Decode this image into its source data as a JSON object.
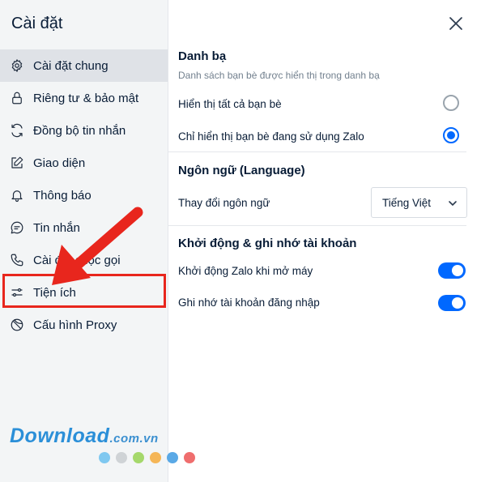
{
  "sidebar": {
    "title": "Cài đặt",
    "items": [
      {
        "label": "Cài đặt chung",
        "icon": "gear-icon"
      },
      {
        "label": "Riêng tư & bảo mật",
        "icon": "lock-icon"
      },
      {
        "label": "Đồng bộ tin nhắn",
        "icon": "sync-icon"
      },
      {
        "label": "Giao diện",
        "icon": "edit-icon"
      },
      {
        "label": "Thông báo",
        "icon": "bell-icon"
      },
      {
        "label": "Tin nhắn",
        "icon": "chat-icon"
      },
      {
        "label": "Cài đặt cuộc gọi",
        "icon": "phone-icon"
      },
      {
        "label": "Tiện ích",
        "icon": "sliders-icon"
      },
      {
        "label": "Cấu hình Proxy",
        "icon": "proxy-icon"
      }
    ]
  },
  "contacts": {
    "title": "Danh bạ",
    "subtitle": "Danh sách bạn bè được hiển thị trong danh bạ",
    "option_all": "Hiển thị tất cả bạn bè",
    "option_zalo": "Chỉ hiển thị bạn bè đang sử dụng Zalo",
    "selected": "option_zalo"
  },
  "language": {
    "title": "Ngôn ngữ (Language)",
    "label": "Thay đổi ngôn ngữ",
    "value": "Tiếng Việt"
  },
  "startup": {
    "title": "Khởi động & ghi nhớ tài khoản",
    "autostart_label": "Khởi động Zalo khi mở máy",
    "autostart_on": true,
    "remember_label": "Ghi nhớ tài khoản đăng nhập",
    "remember_on": true
  },
  "watermark": {
    "brand": "Download",
    "suffix": ".com.vn",
    "dot_colors": [
      "#7fc8f0",
      "#cfd3d6",
      "#a5d86b",
      "#f5b657",
      "#5aa9e6",
      "#ef6e6e"
    ]
  },
  "colors": {
    "accent": "#0068ff",
    "annotation_red": "#e8261d"
  }
}
